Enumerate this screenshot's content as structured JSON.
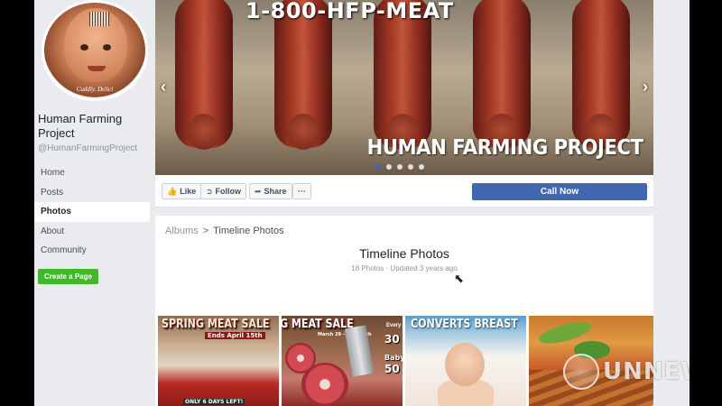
{
  "sidebar": {
    "profile_caption": "Cuddly. Delici",
    "page_name": "Human Farming Project",
    "handle": "@HumanFarmingProject",
    "nav": [
      "Home",
      "Posts",
      "Photos",
      "About",
      "Community"
    ],
    "active_nav": "Photos",
    "create_page": "Create a Page"
  },
  "cover": {
    "phone_text": "1-800-HFP-MEAT",
    "caption_text": "HUMAN FARMING PROJECT",
    "prev_arrow": "‹",
    "next_arrow": "›",
    "slide_count": 5,
    "active_slide": 1
  },
  "actions": {
    "like": "Like",
    "follow": "Follow",
    "share": "Share",
    "more": "···",
    "call_now": "Call Now"
  },
  "albums": {
    "crumb_root": "Albums",
    "crumb_sep": ">",
    "crumb_current": "Timeline Photos",
    "title": "Timeline Photos",
    "meta": "18 Photos · Updated 3 years ago"
  },
  "thumbnails": [
    {
      "title": "SPRING MEAT SALE",
      "sub": "Ends April 15th",
      "bottom": "ONLY 6 DAYS LEFT!"
    },
    {
      "title": "G MEAT SALE",
      "sub": "March 29 - April 15th",
      "tag": "Every",
      "num1": "30",
      "num2": "Baby",
      "num3": "50"
    },
    {
      "title": "CONVERTS BREAST",
      "sub": ""
    },
    {
      "title": "",
      "sub": ""
    }
  ],
  "watermark": {
    "text": "UNNEWS",
    "logo": "un-emblem-icon"
  },
  "colors": {
    "facebook_blue": "#4267b2",
    "create_green": "#42b72a",
    "page_bg": "#e9ebee"
  }
}
